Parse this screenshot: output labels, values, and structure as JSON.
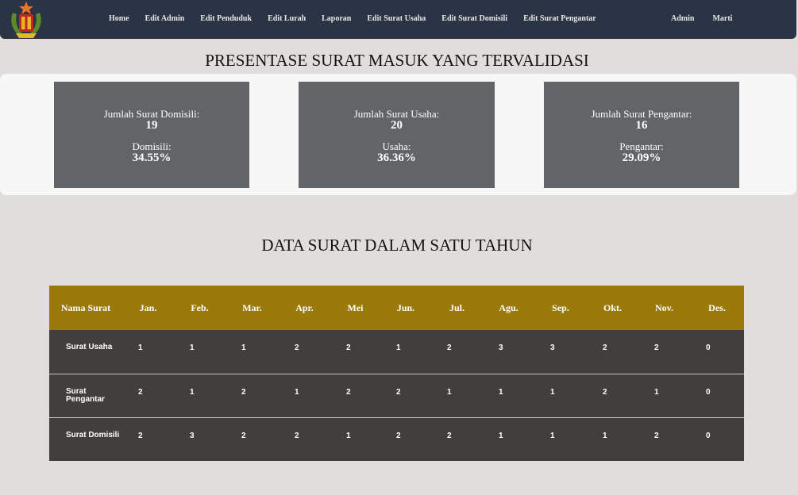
{
  "nav": {
    "links": [
      "Home",
      "Edit Admin",
      "Edit Penduduk",
      "Edit Lurah",
      "Laporan",
      "Edit Surat Usaha",
      "Edit Surat Domisili",
      "Edit Surat Pengantar"
    ],
    "right": [
      "Admin",
      "Marti"
    ]
  },
  "stats": {
    "title": "PRESENTASE SURAT MASUK YANG TERVALIDASI",
    "cards": [
      {
        "label": "Jumlah Surat Domisili:",
        "count": "19",
        "pct_label": "Domisili:",
        "pct": "34.55%"
      },
      {
        "label": "Jumlah Surat Usaha:",
        "count": "20",
        "pct_label": "Usaha:",
        "pct": "36.36%"
      },
      {
        "label": "Jumlah Surat Pengantar:",
        "count": "16",
        "pct_label": "Pengantar:",
        "pct": "29.09%"
      }
    ]
  },
  "table": {
    "title": "DATA SURAT DALAM SATU TAHUN",
    "name_header": "Nama Surat",
    "months": [
      "Jan.",
      "Feb.",
      "Mar.",
      "Apr.",
      "Mei",
      "Jun.",
      "Jul.",
      "Agu.",
      "Sep.",
      "Okt.",
      "Nov.",
      "Des."
    ],
    "rows": [
      {
        "name": "Surat Usaha",
        "values": [
          "1",
          "1",
          "1",
          "2",
          "2",
          "1",
          "2",
          "3",
          "3",
          "2",
          "2",
          "0"
        ]
      },
      {
        "name": "Surat Pengantar",
        "values": [
          "2",
          "1",
          "2",
          "1",
          "2",
          "2",
          "1",
          "1",
          "1",
          "2",
          "1",
          "0"
        ]
      },
      {
        "name": "Surat Domisili",
        "values": [
          "2",
          "3",
          "2",
          "2",
          "1",
          "2",
          "2",
          "1",
          "1",
          "1",
          "2",
          "0"
        ]
      }
    ]
  },
  "colors": {
    "navbar": "#2a3444",
    "card": "#626568",
    "table_header": "#9a7a0a",
    "table_body": "#433e3e",
    "page_bg": "#e2dddd"
  }
}
